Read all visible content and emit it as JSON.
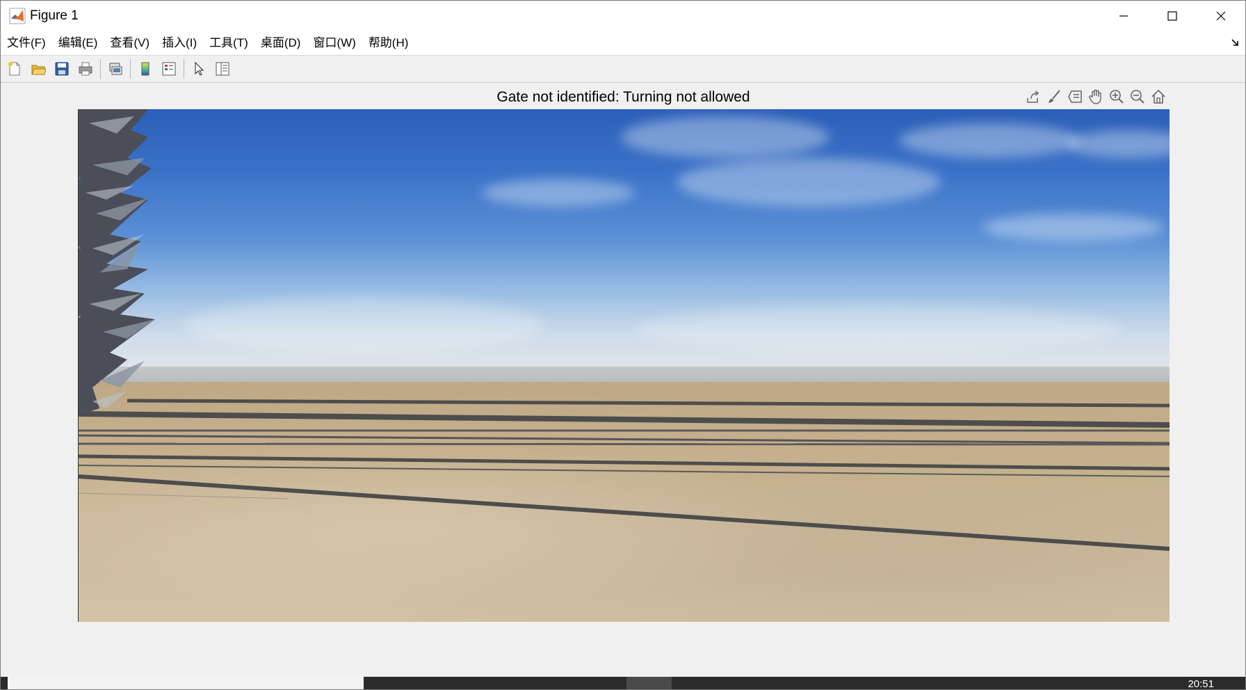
{
  "window": {
    "title": "Figure 1",
    "controls": [
      "minimize-icon",
      "maximize-icon",
      "close-icon"
    ]
  },
  "menubar": {
    "items": [
      {
        "label": "文件(F)"
      },
      {
        "label": "编辑(E)"
      },
      {
        "label": "查看(V)"
      },
      {
        "label": "插入(I)"
      },
      {
        "label": "工具(T)"
      },
      {
        "label": "桌面(D)"
      },
      {
        "label": "窗口(W)"
      },
      {
        "label": "帮助(H)"
      }
    ]
  },
  "toolbar": {
    "buttons": [
      {
        "icon": "new-figure-icon"
      },
      {
        "icon": "open-file-icon"
      },
      {
        "icon": "save-icon"
      },
      {
        "icon": "print-icon"
      },
      {
        "icon": "link-plot-icon"
      },
      {
        "icon": "insert-colorbar-icon"
      },
      {
        "icon": "insert-legend-icon"
      },
      {
        "icon": "edit-plot-icon"
      },
      {
        "icon": "property-inspector-icon"
      }
    ]
  },
  "figure": {
    "title": "Gate not identified: Turning not allowed",
    "axes_toolbar": [
      "export-icon",
      "brush-icon",
      "data-tips-icon",
      "pan-icon",
      "zoom-in-icon",
      "zoom-out-icon",
      "home-icon"
    ]
  },
  "colors": {
    "sky_top": "#2b5fb8",
    "horizon": "#dfe4ea",
    "ground": "#c6b08d",
    "runway_lines": "#4a4a4a"
  },
  "taskbar": {
    "clock": "20:51"
  }
}
